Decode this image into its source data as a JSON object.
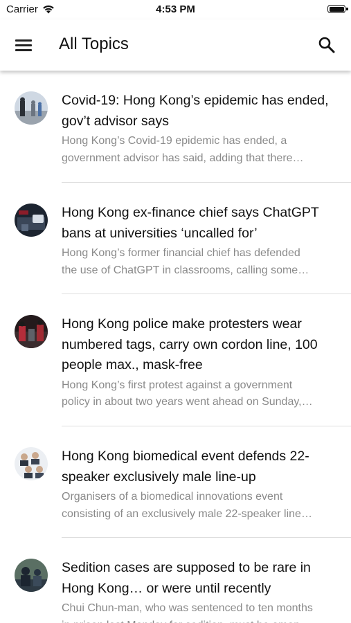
{
  "status_bar": {
    "carrier": "Carrier",
    "time": "4:53 PM"
  },
  "app_bar": {
    "title": "All Topics",
    "menu_icon": "hamburger-menu-icon",
    "search_icon": "search-icon"
  },
  "articles": [
    {
      "headline_lines": [
        "Covid-19: Hong Kong’s epidemic has ended,",
        "gov’t advisor says"
      ],
      "summary_lines": [
        "Hong Kong’s Covid-19 epidemic has ended, a",
        "government advisor has said, adding that there…"
      ]
    },
    {
      "headline_lines": [
        "Hong Kong ex-finance chief says ChatGPT",
        "bans at universities ‘uncalled for’"
      ],
      "summary_lines": [
        "Hong Kong’s former financial chief has defended",
        "the use of ChatGPT in classrooms, calling some…"
      ]
    },
    {
      "headline_lines": [
        "Hong Kong police make protesters wear",
        "numbered tags, carry own cordon line, 100",
        "people max., mask-free"
      ],
      "summary_lines": [
        "Hong Kong’s first protest against a government",
        "policy in about two years went ahead on Sunday,…"
      ]
    },
    {
      "headline_lines": [
        "Hong Kong biomedical event defends 22-",
        "speaker exclusively male line-up"
      ],
      "summary_lines": [
        "Organisers of a biomedical innovations event",
        "consisting of an exclusively male 22-speaker line…"
      ]
    },
    {
      "headline_lines": [
        "Sedition cases are supposed to be rare in",
        "Hong Kong… or were until recently"
      ],
      "summary_lines": [
        "Chui Chun-man, who was sentenced to ten months",
        "in prison last Monday for sedition, must be amon…"
      ]
    }
  ]
}
